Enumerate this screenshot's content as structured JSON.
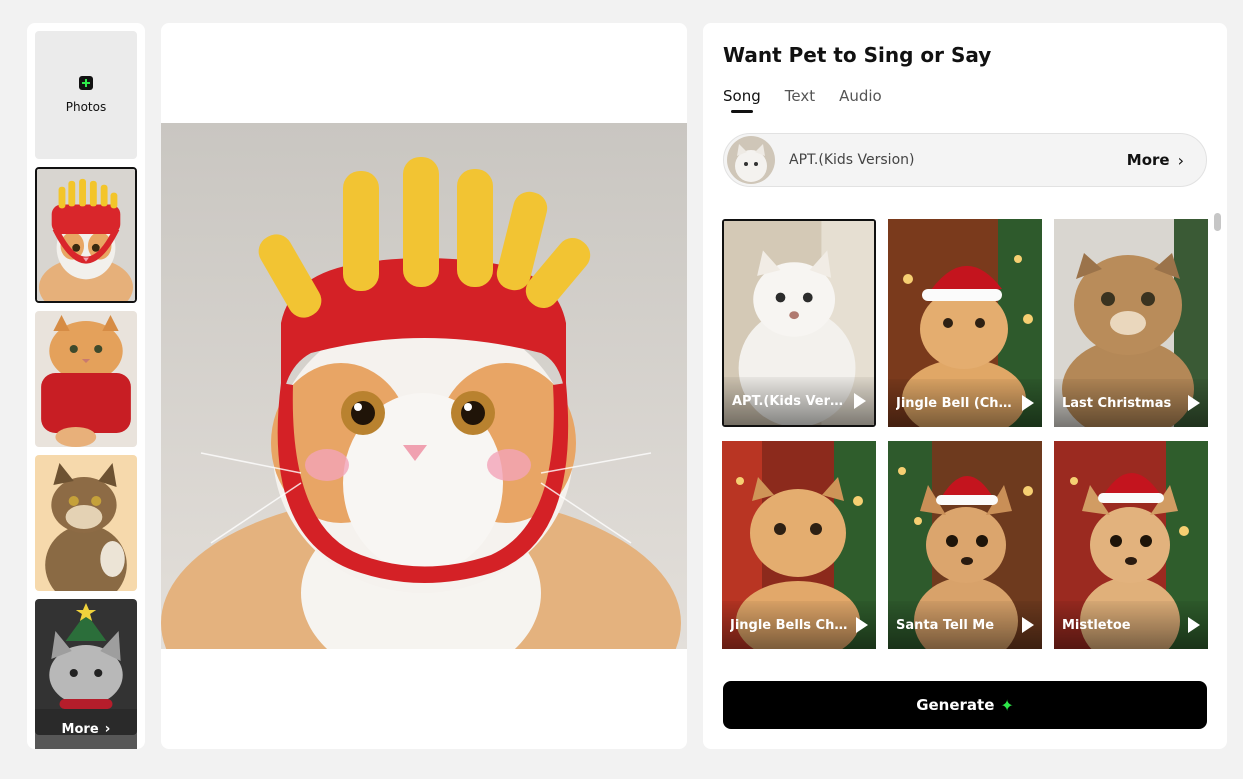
{
  "sidebar": {
    "upload_label": "Photos",
    "more_label": "More"
  },
  "panel": {
    "title": "Want Pet to Sing or Say",
    "tabs": [
      {
        "label": "Song"
      },
      {
        "label": "Text"
      },
      {
        "label": "Audio"
      }
    ],
    "selected_song": "APT.(Kids Version)",
    "more_label": "More",
    "songs": [
      {
        "title": "APT.(Kids Version)"
      },
      {
        "title": "Jingle Bell (Christmas)"
      },
      {
        "title": "Last Christmas"
      },
      {
        "title": "Jingle Bells Christmas"
      },
      {
        "title": "Santa Tell Me"
      },
      {
        "title": "Mistletoe"
      }
    ],
    "generate_label": "Generate"
  },
  "colors": {
    "accent_green": "#2ee84a",
    "button_black": "#000000"
  }
}
